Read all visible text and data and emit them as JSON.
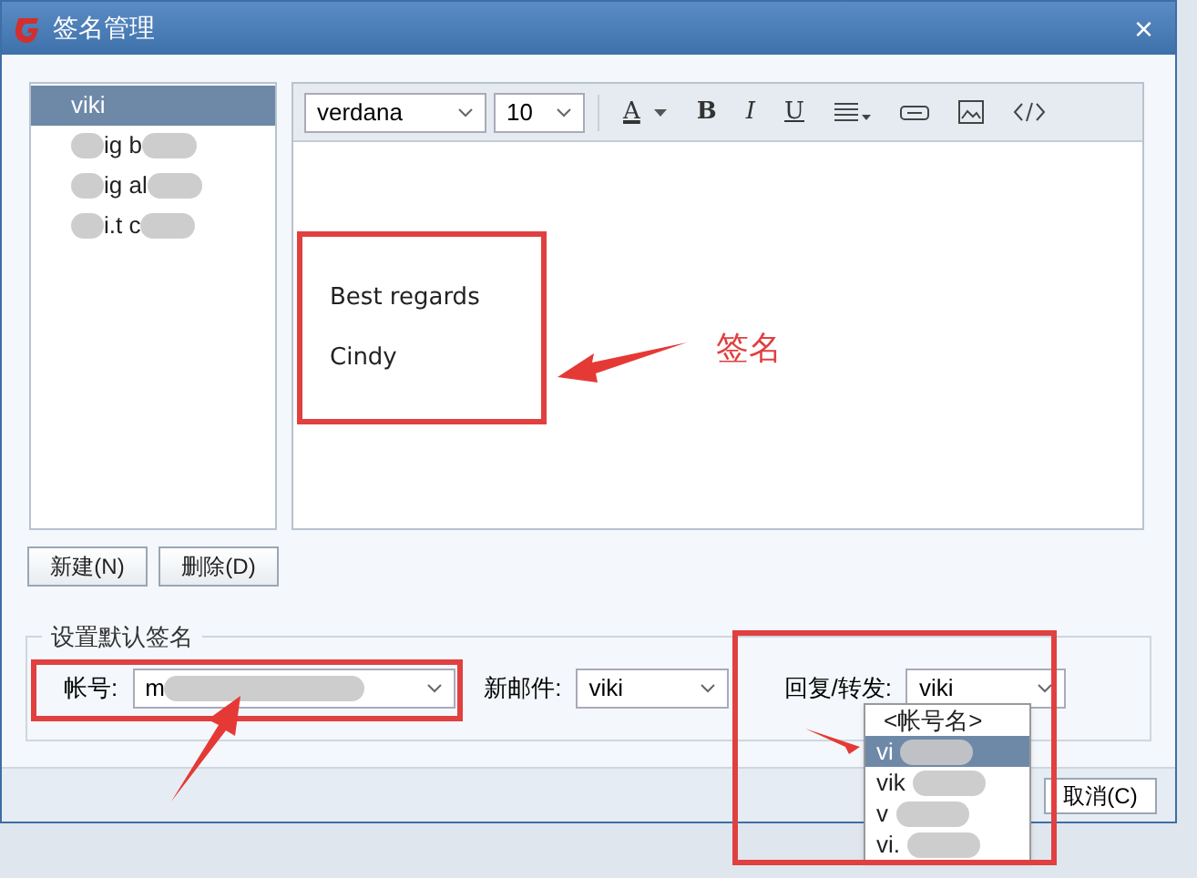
{
  "window": {
    "title": "签名管理",
    "close": "×"
  },
  "signatures": [
    {
      "name": "viki",
      "selected": true,
      "redacted": false
    },
    {
      "name": "ig b",
      "selected": false,
      "redacted": true
    },
    {
      "name": "ig al",
      "selected": false,
      "redacted": true
    },
    {
      "name": "i.t c",
      "selected": false,
      "redacted": true
    }
  ],
  "toolbar": {
    "font": "verdana",
    "size": "10",
    "buttons": [
      {
        "kind": "color",
        "label": "A"
      },
      {
        "kind": "bold",
        "label": "B"
      },
      {
        "kind": "italic",
        "label": "I"
      },
      {
        "kind": "underline",
        "label": "U"
      },
      {
        "kind": "align"
      },
      {
        "kind": "link"
      },
      {
        "kind": "image"
      },
      {
        "kind": "code"
      }
    ]
  },
  "editor": {
    "lines": [
      "Best regards",
      "Cindy"
    ]
  },
  "annotation": {
    "label": "签名"
  },
  "actions": [
    {
      "label": "新建(N)"
    },
    {
      "label": "删除(D)"
    }
  ],
  "defaults": {
    "title": "设置默认签名",
    "fields": [
      {
        "label": "帐号:",
        "value": "m",
        "redacted": true
      },
      {
        "label": "新邮件:",
        "value": "viki",
        "redacted": false
      },
      {
        "label": "回复/转发:",
        "value": "viki",
        "redacted": false
      }
    ],
    "dropdown": [
      {
        "text": "<帐号名>",
        "selected": false
      },
      {
        "text": "vi",
        "selected": true
      },
      {
        "text": "vik",
        "selected": false
      },
      {
        "text": "v",
        "selected": false
      },
      {
        "text": "vi.",
        "selected": false
      }
    ]
  },
  "footer": {
    "cancel": "取消(C)"
  }
}
